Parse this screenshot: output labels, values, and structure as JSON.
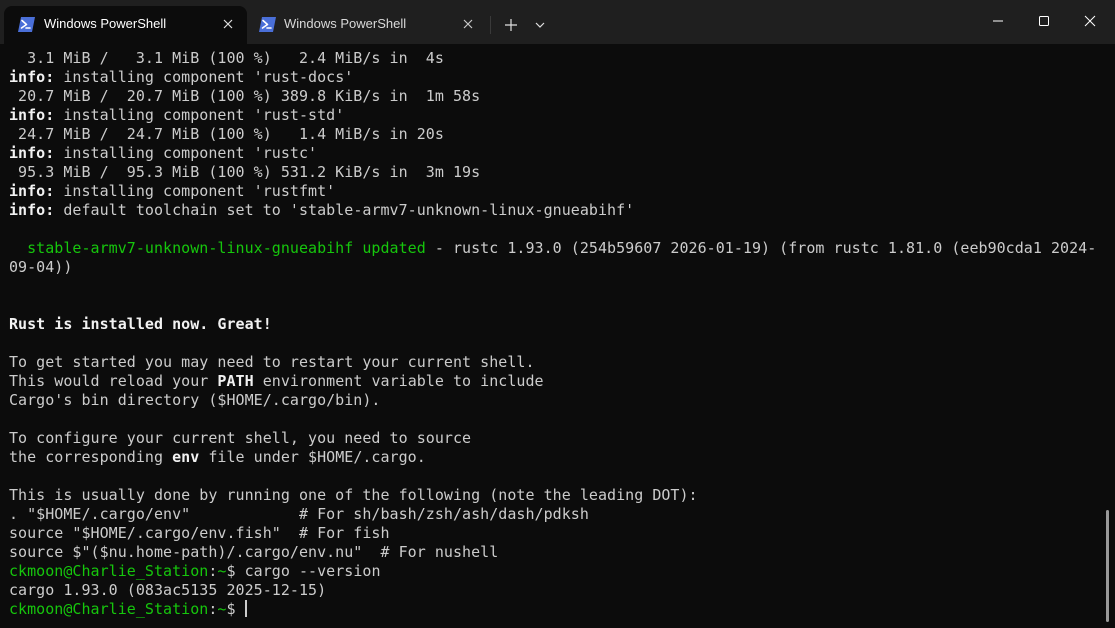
{
  "tabs": [
    {
      "title": "Windows PowerShell",
      "active": true
    },
    {
      "title": "Windows PowerShell",
      "active": false
    }
  ],
  "colors": {
    "background": "#0c0c0c",
    "titlebar": "#1f1f1f",
    "text": "#cccccc",
    "bold_text": "#f2f2f2",
    "green": "#16c60c",
    "tab_icon": "#5e7de8"
  },
  "icons": {
    "tab_icon": "powershell-icon",
    "new_tab": "plus-icon",
    "dropdown": "chevron-down-icon",
    "minimize": "minimize-icon",
    "maximize": "maximize-icon",
    "close": "close-icon"
  },
  "terminal": {
    "lines": [
      [
        {
          "t": "  3.1 MiB /   3.1 MiB (100 %)   2.4 MiB/s in  4s"
        }
      ],
      [
        {
          "t": "info:",
          "s": "b"
        },
        {
          "t": " installing component 'rust-docs'"
        }
      ],
      [
        {
          "t": " 20.7 MiB /  20.7 MiB (100 %) 389.8 KiB/s in  1m 58s"
        }
      ],
      [
        {
          "t": "info:",
          "s": "b"
        },
        {
          "t": " installing component 'rust-std'"
        }
      ],
      [
        {
          "t": " 24.7 MiB /  24.7 MiB (100 %)   1.4 MiB/s in 20s"
        }
      ],
      [
        {
          "t": "info:",
          "s": "b"
        },
        {
          "t": " installing component 'rustc'"
        }
      ],
      [
        {
          "t": " 95.3 MiB /  95.3 MiB (100 %) 531.2 KiB/s in  3m 19s"
        }
      ],
      [
        {
          "t": "info:",
          "s": "b"
        },
        {
          "t": " installing component 'rustfmt'"
        }
      ],
      [
        {
          "t": "info:",
          "s": "b"
        },
        {
          "t": " default toolchain set to 'stable-armv7-unknown-linux-gnueabihf'"
        }
      ],
      [],
      [
        {
          "t": "  stable-armv7-unknown-linux-gnueabihf updated",
          "s": "green"
        },
        {
          "t": " - rustc 1.93.0 (254b59607 2026-01-19) (from rustc 1.81.0 (eeb90cda1 2024-"
        }
      ],
      [
        {
          "t": "09-04))"
        }
      ],
      [],
      [],
      [
        {
          "t": "Rust is installed now. Great!",
          "s": "b"
        }
      ],
      [],
      [
        {
          "t": "To get started you may need to restart your current shell."
        }
      ],
      [
        {
          "t": "This would reload your "
        },
        {
          "t": "PATH",
          "s": "b"
        },
        {
          "t": " environment variable to include"
        }
      ],
      [
        {
          "t": "Cargo's bin directory ($HOME/.cargo/bin)."
        }
      ],
      [],
      [
        {
          "t": "To configure your current shell, you need to source"
        }
      ],
      [
        {
          "t": "the corresponding "
        },
        {
          "t": "env",
          "s": "b"
        },
        {
          "t": " file under $HOME/.cargo."
        }
      ],
      [],
      [
        {
          "t": "This is usually done by running one of the following (note the leading DOT):"
        }
      ],
      [
        {
          "t": ". \"$HOME/.cargo/env\"            # For sh/bash/zsh/ash/dash/pdksh"
        }
      ],
      [
        {
          "t": "source \"$HOME/.cargo/env.fish\"  # For fish"
        }
      ],
      [
        {
          "t": "source $\"($nu.home-path)/.cargo/env.nu\"  # For nushell"
        }
      ],
      [
        {
          "t": "ckmoon@Charlie_Station",
          "s": "green"
        },
        {
          "t": ":"
        },
        {
          "t": "~",
          "s": "green"
        },
        {
          "t": "$ cargo --version"
        }
      ],
      [
        {
          "t": "cargo 1.93.0 (083ac5135 2025-12-15)"
        }
      ],
      [
        {
          "t": "ckmoon@Charlie_Station",
          "s": "green"
        },
        {
          "t": ":"
        },
        {
          "t": "~",
          "s": "green"
        },
        {
          "t": "$ "
        }
      ]
    ]
  }
}
